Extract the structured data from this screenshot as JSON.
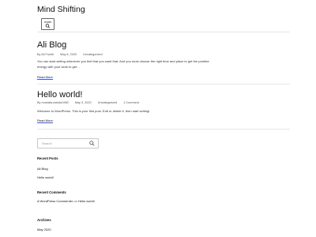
{
  "site": {
    "title": "Mind Shifting"
  },
  "menu": {
    "label": "main",
    "icon": "search-icon"
  },
  "posts": [
    {
      "title": "Ali Blog",
      "author": "By Ali Fouhti",
      "date": "May 6, 2020",
      "category": "Uncategorized",
      "comments": "",
      "excerpt": "You can start writing whenever you feel that you want that. And you must choose the right time and place to get the positive energy with your work to get…",
      "read_more": "Read More"
    },
    {
      "title": "Hello world!",
      "author": "By mustafa.wahda1980",
      "date": "May 3, 2020",
      "category": "Uncategorized",
      "comments": "1 Comment",
      "excerpt": "Welcome to WordPress. This is your first post. Edit or delete it, then start writing!",
      "read_more": "Read More"
    }
  ],
  "sidebar": {
    "search_placeholder": "Search",
    "search_icon": "search-icon",
    "recent_posts_title": "Recent Posts",
    "recent_posts": [
      "Ali Blog",
      "Hello world!"
    ],
    "recent_comments_title": "Recent Comments",
    "comment": {
      "author": "A WordPress Commenter",
      "on": "on",
      "post": "Hello world!"
    },
    "archives_title": "Archives",
    "archives": [
      "May 2020"
    ]
  }
}
